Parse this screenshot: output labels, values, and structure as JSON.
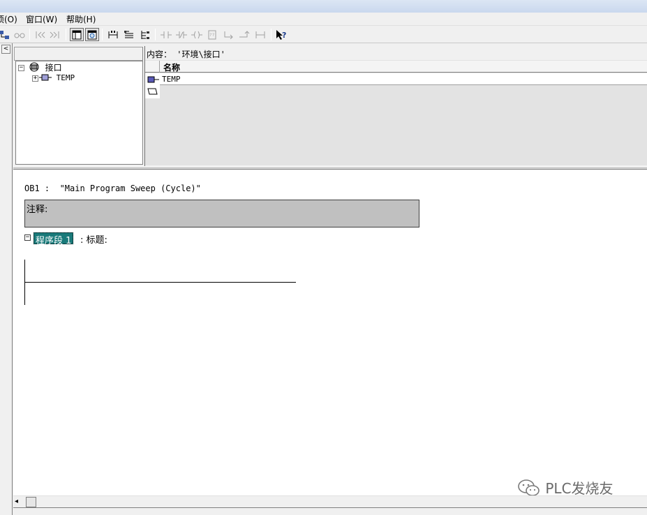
{
  "menu": [
    {
      "label": "项(O)"
    },
    {
      "label": "窗口(W)"
    },
    {
      "label": "帮助(H)"
    }
  ],
  "toolbar": {
    "buttons": [
      "network-icon",
      "glasses-icon",
      "first-icon",
      "last-icon",
      "overview-icon",
      "preview-icon",
      "branch-icon",
      "detail-icon",
      "tree-icon",
      "no-contact-icon",
      "nc-contact-icon",
      "coil-icon",
      "box-icon",
      "open-branch-icon",
      "close-branch-icon",
      "connect-icon",
      "help-icon"
    ]
  },
  "left_strip": {
    "arrow": "<"
  },
  "tree": {
    "root_label": "接口",
    "child_label": "TEMP",
    "root_toggle": "−",
    "child_toggle": "+"
  },
  "content": {
    "title": "内容： '环境\\接口'",
    "column_name": "名称",
    "rows": [
      {
        "name": "TEMP"
      }
    ]
  },
  "editor": {
    "block_title": "OB1 :  \"Main Program Sweep (Cycle)\"",
    "comment_label": "注释:",
    "network_toggle": "−",
    "network_label": "程序段 1",
    "network_title": ": 标题:"
  },
  "watermark": "PLC发烧友",
  "scrollbar": {
    "left_arrow": "◂"
  }
}
